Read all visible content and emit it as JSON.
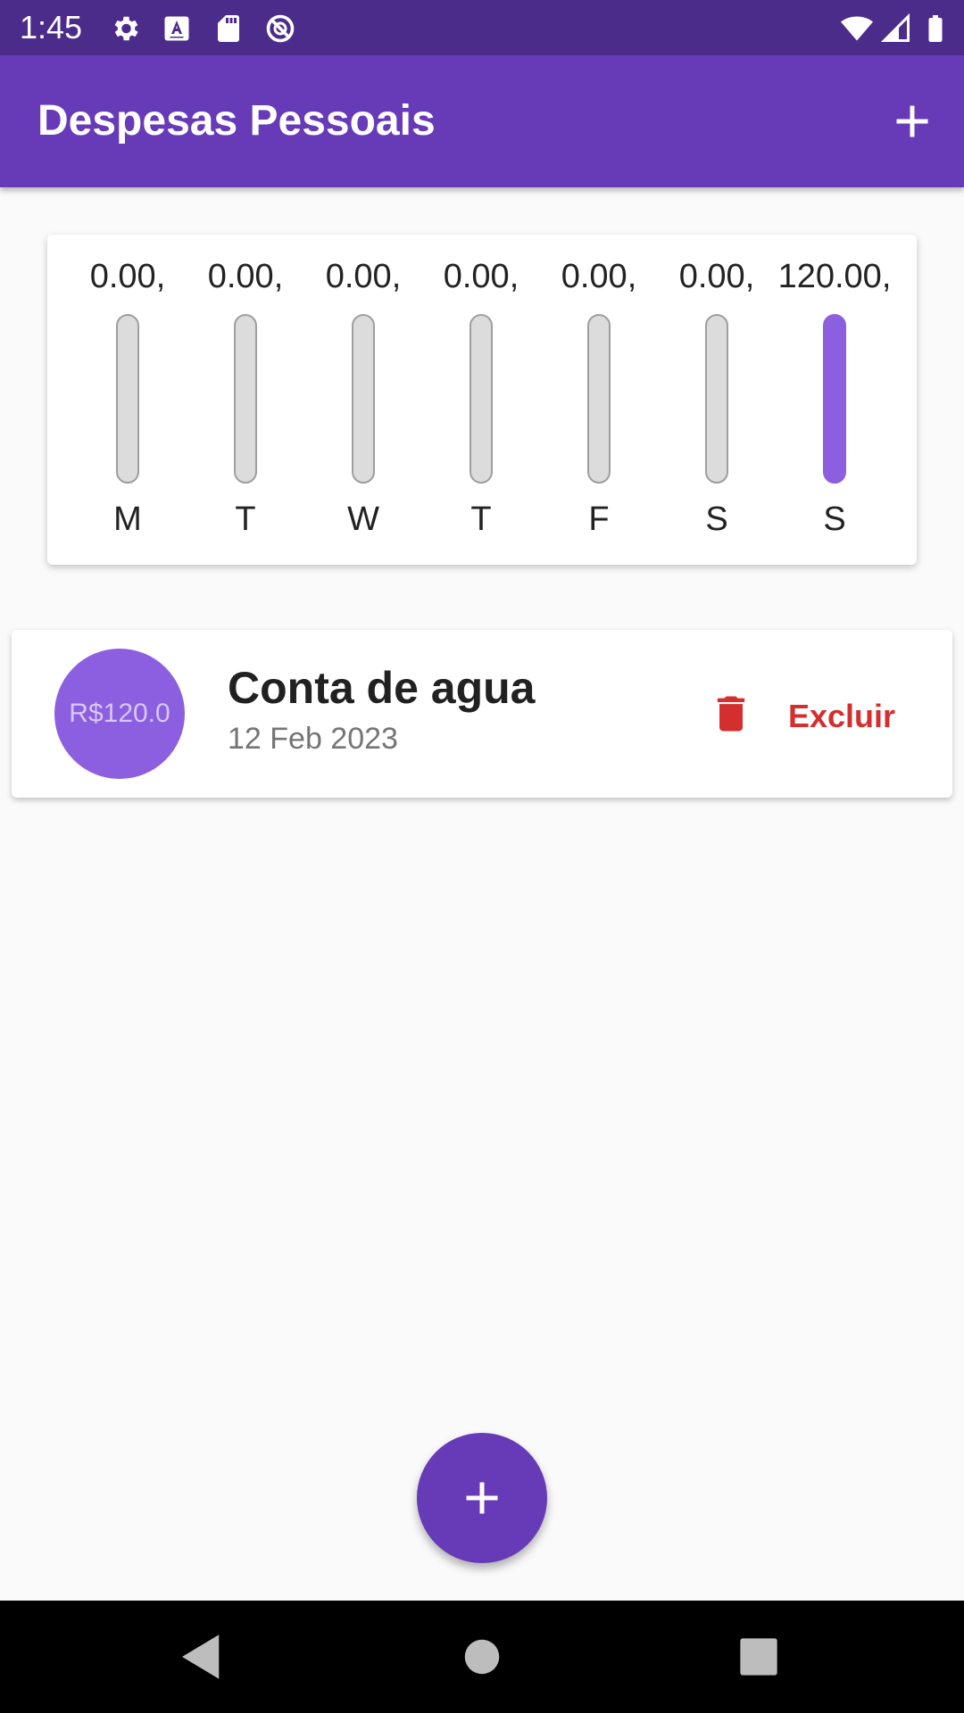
{
  "status_bar": {
    "time": "1:45",
    "left_icons": [
      "gear-icon",
      "font-a-icon",
      "sd-card-icon",
      "do-not-disturb-icon"
    ],
    "right_icons": [
      "wifi-icon",
      "cell-signal-icon",
      "battery-icon"
    ]
  },
  "app_bar": {
    "title": "Despesas Pessoais",
    "action_icon": "plus-icon"
  },
  "colors": {
    "status_bar": "#4c2c8a",
    "primary": "#673ab7",
    "accent": "#8c5ee0",
    "delete": "#d32f2f"
  },
  "chart_data": {
    "type": "bar",
    "categories": [
      "M",
      "T",
      "W",
      "T",
      "F",
      "S",
      "S"
    ],
    "values": [
      0,
      0,
      0,
      0,
      0,
      0,
      120
    ],
    "value_labels": [
      "0.00,",
      "0.00,",
      "0.00,",
      "0.00,",
      "0.00,",
      "0.00,",
      "120.00,"
    ],
    "fill_fractions": [
      0,
      0,
      0,
      0,
      0,
      0,
      1
    ],
    "title": "",
    "xlabel": "",
    "ylabel": ""
  },
  "transactions": [
    {
      "amount": "R$120.0",
      "title": "Conta de agua",
      "date": "12 Feb 2023",
      "delete_label": "Excluir",
      "delete_icon": "trash-icon"
    }
  ],
  "fab": {
    "icon": "plus-icon"
  },
  "nav_bar": {
    "icons": [
      "back-icon",
      "home-icon",
      "recents-icon"
    ]
  }
}
